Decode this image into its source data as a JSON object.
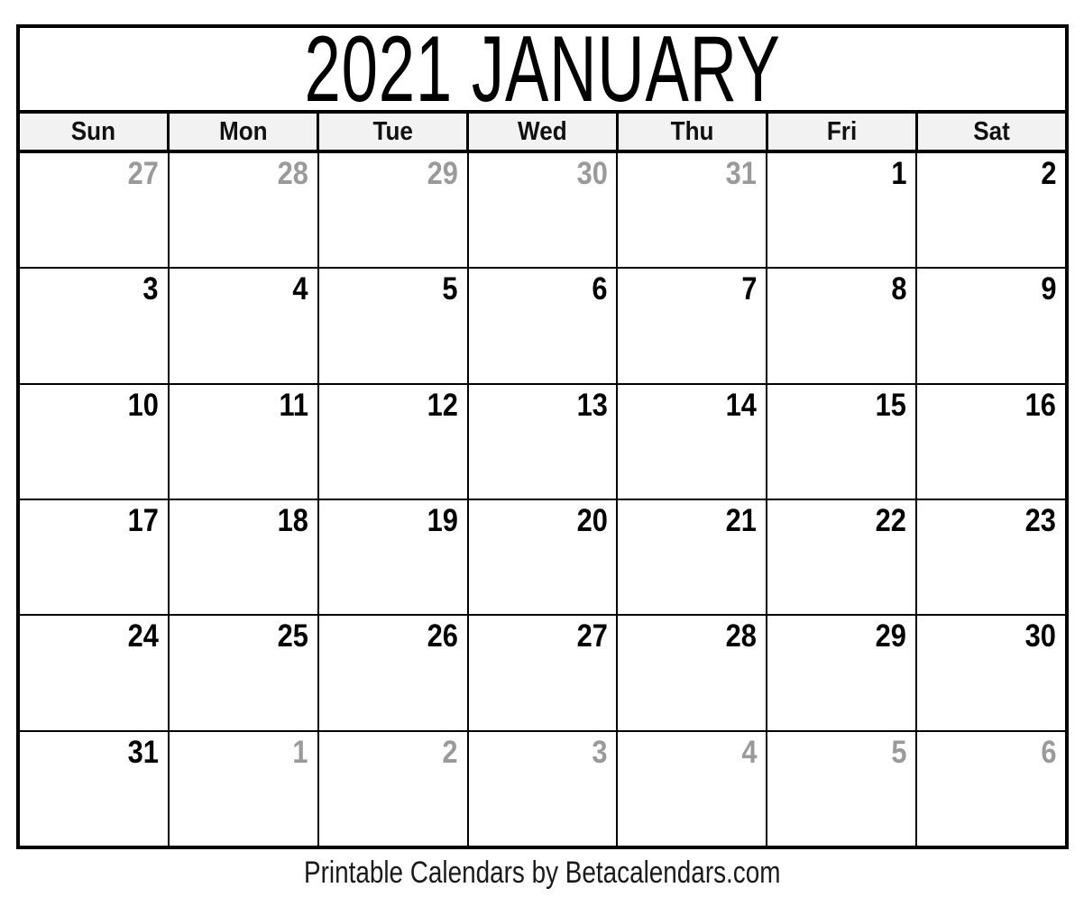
{
  "calendar": {
    "title": "2021 JANUARY",
    "year": "2021",
    "month": "JANUARY",
    "weekday_headers": [
      {
        "label": "Sun"
      },
      {
        "label": "Mon"
      },
      {
        "label": "Tue"
      },
      {
        "label": "Wed"
      },
      {
        "label": "Thu"
      },
      {
        "label": "Fri"
      },
      {
        "label": "Sat"
      }
    ],
    "weeks": [
      [
        {
          "day": "27",
          "current_month": false
        },
        {
          "day": "28",
          "current_month": false
        },
        {
          "day": "29",
          "current_month": false
        },
        {
          "day": "30",
          "current_month": false
        },
        {
          "day": "31",
          "current_month": false
        },
        {
          "day": "1",
          "current_month": true
        },
        {
          "day": "2",
          "current_month": true
        }
      ],
      [
        {
          "day": "3",
          "current_month": true
        },
        {
          "day": "4",
          "current_month": true
        },
        {
          "day": "5",
          "current_month": true
        },
        {
          "day": "6",
          "current_month": true
        },
        {
          "day": "7",
          "current_month": true
        },
        {
          "day": "8",
          "current_month": true
        },
        {
          "day": "9",
          "current_month": true
        }
      ],
      [
        {
          "day": "10",
          "current_month": true
        },
        {
          "day": "11",
          "current_month": true
        },
        {
          "day": "12",
          "current_month": true
        },
        {
          "day": "13",
          "current_month": true
        },
        {
          "day": "14",
          "current_month": true
        },
        {
          "day": "15",
          "current_month": true
        },
        {
          "day": "16",
          "current_month": true
        }
      ],
      [
        {
          "day": "17",
          "current_month": true
        },
        {
          "day": "18",
          "current_month": true
        },
        {
          "day": "19",
          "current_month": true
        },
        {
          "day": "20",
          "current_month": true
        },
        {
          "day": "21",
          "current_month": true
        },
        {
          "day": "22",
          "current_month": true
        },
        {
          "day": "23",
          "current_month": true
        }
      ],
      [
        {
          "day": "24",
          "current_month": true
        },
        {
          "day": "25",
          "current_month": true
        },
        {
          "day": "26",
          "current_month": true
        },
        {
          "day": "27",
          "current_month": true
        },
        {
          "day": "28",
          "current_month": true
        },
        {
          "day": "29",
          "current_month": true
        },
        {
          "day": "30",
          "current_month": true
        }
      ],
      [
        {
          "day": "31",
          "current_month": true
        },
        {
          "day": "1",
          "current_month": false
        },
        {
          "day": "2",
          "current_month": false
        },
        {
          "day": "3",
          "current_month": false
        },
        {
          "day": "4",
          "current_month": false
        },
        {
          "day": "5",
          "current_month": false
        },
        {
          "day": "6",
          "current_month": false
        }
      ]
    ]
  },
  "footer": {
    "text": "Printable Calendars by Betacalendars.com"
  },
  "colors": {
    "border": "#000000",
    "header_background": "#f2f2f2",
    "current_month_text": "#000000",
    "other_month_text": "#9a9a9a",
    "page_background": "#ffffff"
  }
}
